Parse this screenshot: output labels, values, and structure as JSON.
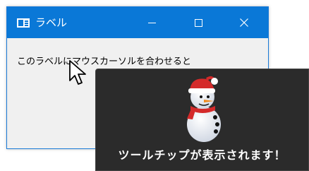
{
  "window": {
    "title": "ラベル",
    "label_text": "このラベルにマウスカーソルを合わせると"
  },
  "tooltip": {
    "text": "ツールチップが表示されます！",
    "image": "snowman"
  },
  "colors": {
    "titlebar": "#0a78d7",
    "window_bg": "#f0f0f0",
    "tooltip_bg": "#2b2b2b"
  }
}
